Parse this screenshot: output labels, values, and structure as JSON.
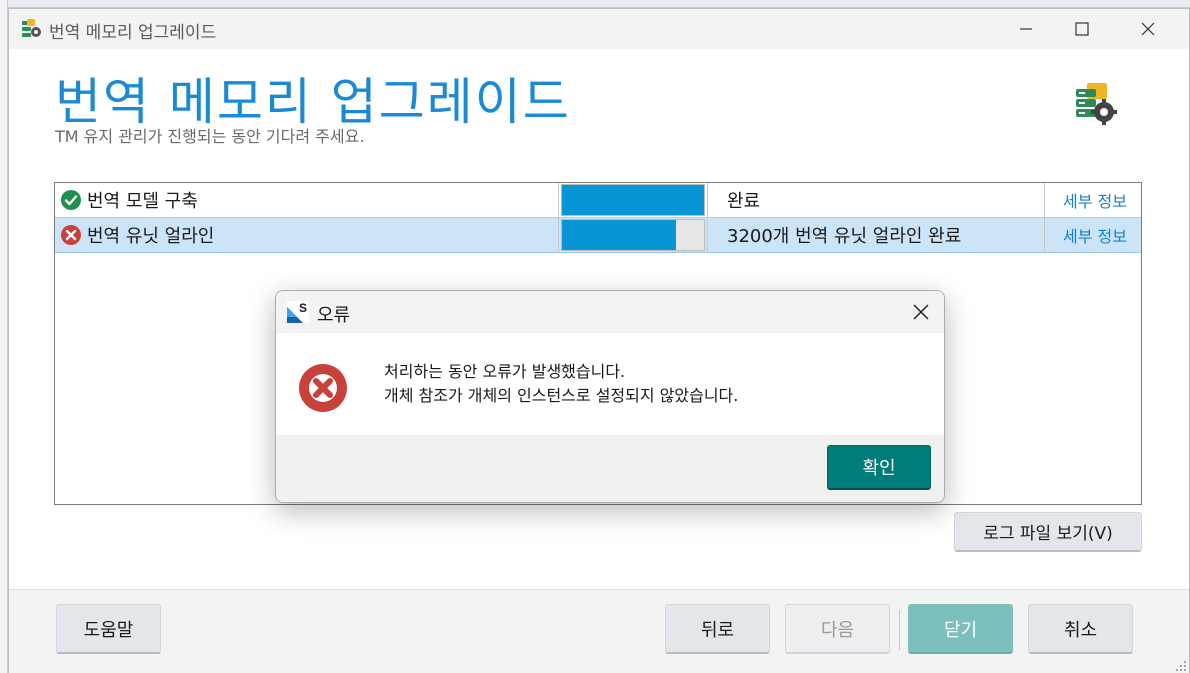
{
  "window": {
    "title": "번역 메모리 업그레이드"
  },
  "header": {
    "title": "번역 메모리 업그레이드",
    "subtitle": "TM 유지 관리가 진행되는 동안 기다려 주세요."
  },
  "tasks": [
    {
      "name": "번역 모델 구축",
      "status_icon": "check-circle-icon",
      "progress": 1.0,
      "status": "완료",
      "details_link": "세부 정보"
    },
    {
      "name": "번역 유닛 얼라인",
      "status_icon": "error-circle-icon",
      "progress": 0.8,
      "status": "3200개 번역 유닛 얼라인 완료",
      "details_link": "세부 정보"
    }
  ],
  "log_button": "로그 파일 보기(V)",
  "footer": {
    "help": "도움말",
    "back": "뒤로",
    "next": "다음",
    "close": "닫기",
    "cancel": "취소"
  },
  "dialog": {
    "title": "오류",
    "line1": "처리하는 동안 오류가 발생했습니다.",
    "line2": "개체 참조가 개체의 인스턴스로 설정되지 않았습니다.",
    "ok": "확인"
  },
  "colors": {
    "accent": "#1a8ad4",
    "progress": "#0895d6",
    "ok_button": "#007c7a",
    "selected_row": "#cce4f7",
    "success": "#1e8f4e",
    "error": "#c8423b"
  }
}
